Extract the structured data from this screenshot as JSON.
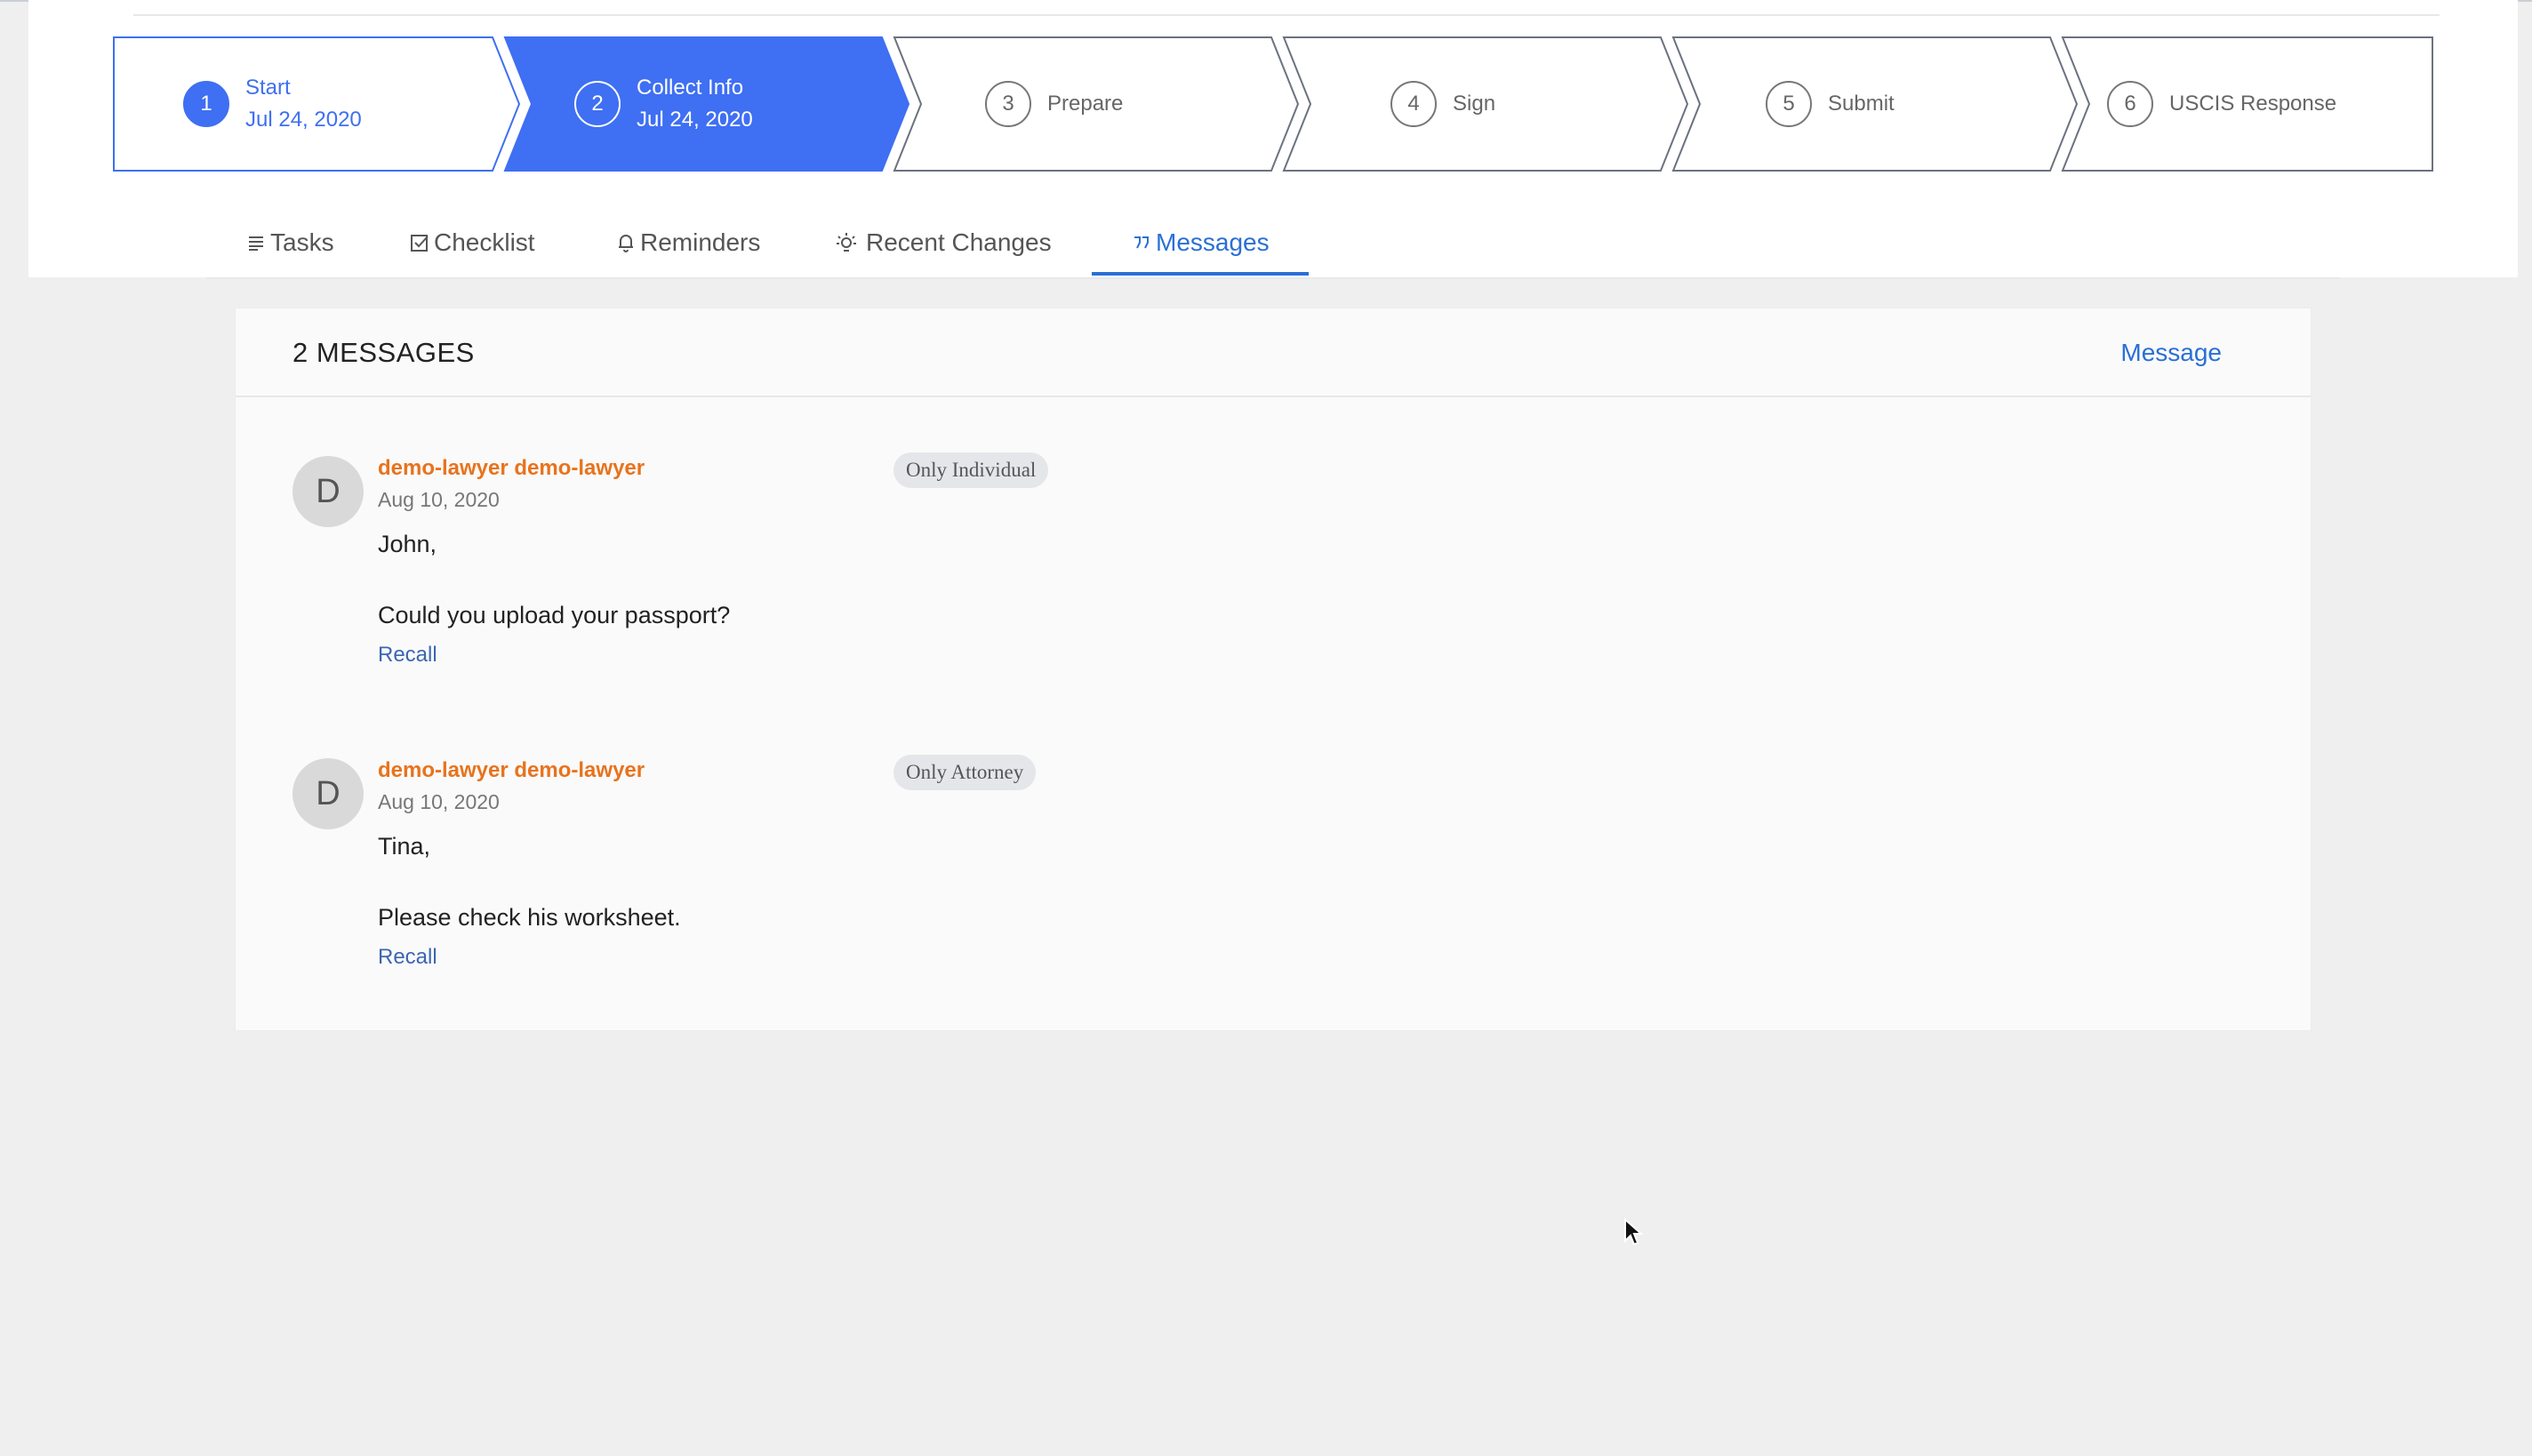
{
  "stepper": {
    "steps": [
      {
        "number": "1",
        "label": "Start",
        "date": "Jul 24, 2020"
      },
      {
        "number": "2",
        "label": "Collect Info",
        "date": "Jul 24, 2020"
      },
      {
        "number": "3",
        "label": "Prepare"
      },
      {
        "number": "4",
        "label": "Sign"
      },
      {
        "number": "5",
        "label": "Submit"
      },
      {
        "number": "6",
        "label": "USCIS Response"
      }
    ],
    "colors": {
      "active": "#3f6ff2",
      "completed_text": "#3f6ff2",
      "border": "#6b7280"
    }
  },
  "tabs": [
    {
      "label": "Tasks",
      "icon": "list-icon"
    },
    {
      "label": "Checklist",
      "icon": "checkbox-icon"
    },
    {
      "label": "Reminders",
      "icon": "bell-icon"
    },
    {
      "label": "Recent Changes",
      "icon": "lightbulb-icon"
    },
    {
      "label": "Messages",
      "icon": "quote-icon",
      "active": true
    }
  ],
  "messages_panel": {
    "title": "2 MESSAGES",
    "message_button": "Message",
    "items": [
      {
        "avatar": "D",
        "author": "demo-lawyer demo-lawyer",
        "visibility": "Only Individual",
        "date": "Aug 10, 2020",
        "greeting": "John,",
        "body": "Could you upload your passport?",
        "recall": "Recall"
      },
      {
        "avatar": "D",
        "author": "demo-lawyer demo-lawyer",
        "visibility": "Only Attorney",
        "date": "Aug 10, 2020",
        "greeting": "Tina,",
        "body": "Please check his worksheet.",
        "recall": "Recall"
      }
    ]
  },
  "colors": {
    "link": "#2a6fd6",
    "author": "#e8731d",
    "background": "#efefef"
  }
}
